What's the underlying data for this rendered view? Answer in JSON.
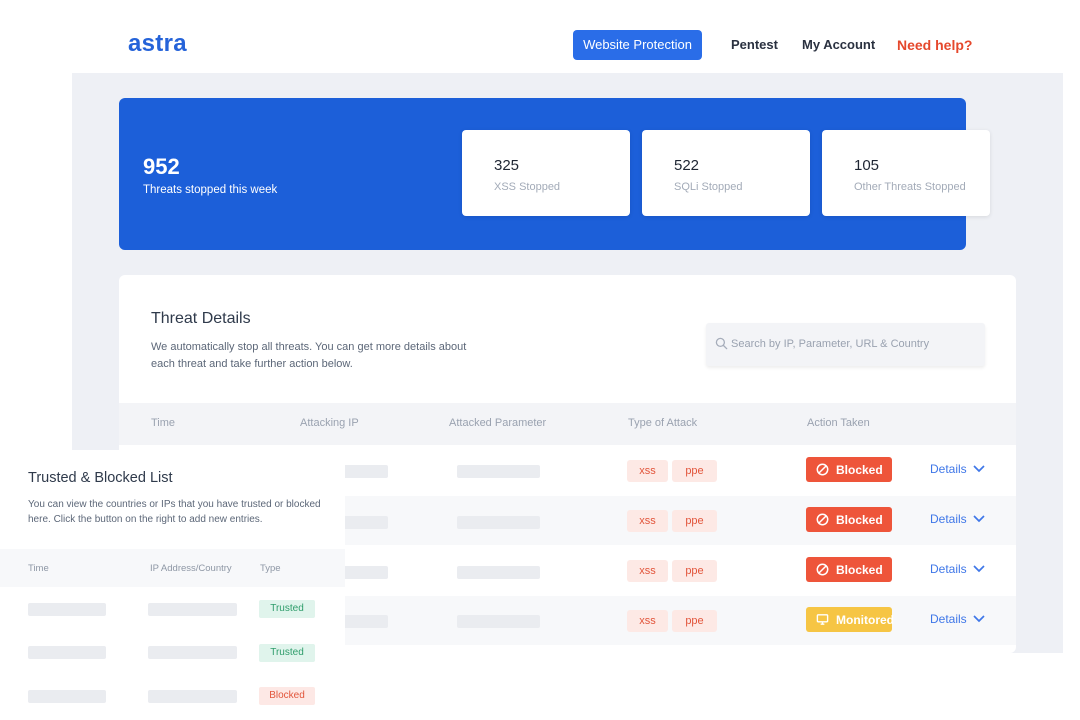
{
  "header": {
    "logo": "astra",
    "nav": {
      "website_protection": "Website Protection",
      "pentest": "Pentest",
      "my_account": "My Account",
      "need_help": "Need help?"
    }
  },
  "stats": {
    "total": "952",
    "total_label": "Threats stopped this week",
    "cards": [
      {
        "value": "325",
        "label": "XSS Stopped"
      },
      {
        "value": "522",
        "label": "SQLi Stopped"
      },
      {
        "value": "105",
        "label": "Other Threats Stopped"
      }
    ]
  },
  "threats": {
    "title": "Threat Details",
    "description": "We automatically stop all threats. You can get more details about each threat and take further action below.",
    "search_placeholder": "Search by IP, Parameter, URL & Country",
    "columns": [
      "Time",
      "Attacking IP",
      "Attacked Parameter",
      "Type of Attack",
      "Action Taken"
    ],
    "rows": [
      {
        "tags": [
          "xss",
          "ppe"
        ],
        "action": "Blocked",
        "status": "blocked",
        "details": "Details"
      },
      {
        "tags": [
          "xss",
          "ppe"
        ],
        "action": "Blocked",
        "status": "blocked",
        "details": "Details"
      },
      {
        "tags": [
          "xss",
          "ppe"
        ],
        "action": "Blocked",
        "status": "blocked",
        "details": "Details"
      },
      {
        "tags": [
          "xss",
          "ppe"
        ],
        "action": "Monitored",
        "status": "monitored",
        "details": "Details"
      }
    ]
  },
  "trusted_blocked": {
    "title": "Trusted & Blocked List",
    "description": "You can view the countries or IPs that you have trusted or blocked here. Click the button on the right to add new entries.",
    "columns": [
      "Time",
      "IP Address/Country",
      "Type"
    ],
    "rows": [
      {
        "type": "Trusted",
        "status": "trusted"
      },
      {
        "type": "Trusted",
        "status": "trusted"
      },
      {
        "type": "Blocked",
        "status": "blocked"
      }
    ]
  },
  "colors": {
    "brand_blue": "#1c5fd9",
    "blocked": "#ee553a",
    "monitored": "#f6c544",
    "link": "#3f77e8",
    "help": "#e5482c"
  }
}
